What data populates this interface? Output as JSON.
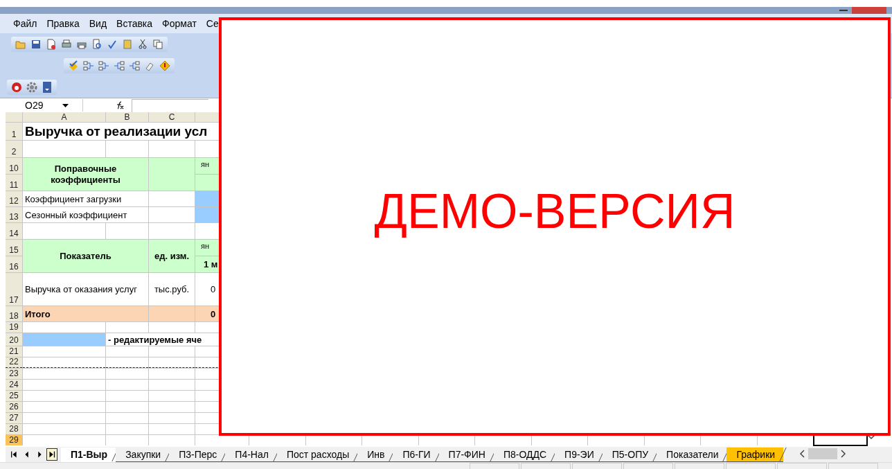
{
  "menu": [
    "Файл",
    "Правка",
    "Вид",
    "Вставка",
    "Формат",
    "Се"
  ],
  "formula_bar": {
    "name_box": "O29"
  },
  "columns": [
    "A",
    "B",
    "C"
  ],
  "rows": [
    {
      "number": "1",
      "selected": false,
      "page_break": false,
      "cells": [
        {
          "kind": "title",
          "text": "Выручка от реализации усл"
        }
      ]
    },
    {
      "number": "2",
      "selected": false,
      "page_break": false,
      "cells": []
    },
    {
      "number": "10",
      "selected": false,
      "page_break": false,
      "cells": [
        {
          "kind": "header",
          "text": "Поправочные коэффициенты"
        },
        {
          "kind": "header"
        },
        {
          "kind": "subheader",
          "text": "ян"
        }
      ]
    },
    {
      "number": "11",
      "selected": false,
      "page_break": false,
      "cells": [
        {
          "kind": "header"
        }
      ]
    },
    {
      "number": "12",
      "selected": false,
      "page_break": false,
      "cells": [
        {
          "kind": "label",
          "text": "Коэффициент загрузки"
        },
        {
          "kind": "plain"
        },
        {
          "kind": "edit"
        }
      ]
    },
    {
      "number": "13",
      "selected": false,
      "page_break": false,
      "cells": [
        {
          "kind": "label",
          "text": "Сезонный коэффициент"
        },
        {
          "kind": "plain"
        },
        {
          "kind": "edit"
        }
      ]
    },
    {
      "number": "14",
      "selected": false,
      "page_break": false,
      "cells": []
    },
    {
      "number": "15",
      "selected": false,
      "page_break": false,
      "cells": [
        {
          "kind": "header",
          "text": "Показатель"
        },
        {
          "kind": "header",
          "text": "ед. изм."
        },
        {
          "kind": "subheader",
          "text": "ян"
        }
      ]
    },
    {
      "number": "16",
      "selected": false,
      "page_break": false,
      "cells": [
        {
          "kind": "header",
          "text": "1 м"
        }
      ]
    },
    {
      "number": "17",
      "selected": false,
      "page_break": false,
      "cells": [
        {
          "kind": "label",
          "text": "Выручка от оказания услуг"
        },
        {
          "kind": "unit",
          "text": "тыс.руб."
        },
        {
          "kind": "value",
          "text": "0"
        }
      ]
    },
    {
      "number": "18",
      "selected": false,
      "page_break": false,
      "cells": [
        {
          "kind": "total",
          "text": "Итого"
        },
        {
          "kind": "total"
        },
        {
          "kind": "total_value",
          "text": "0"
        }
      ]
    },
    {
      "number": "19",
      "selected": false,
      "page_break": false,
      "cells": []
    },
    {
      "number": "20",
      "selected": false,
      "page_break": false,
      "cells": [
        {
          "kind": "edit"
        },
        {
          "kind": "note",
          "text": "- редактируемые яче"
        }
      ]
    },
    {
      "number": "21",
      "selected": false,
      "page_break": false,
      "cells": []
    },
    {
      "number": "22",
      "selected": false,
      "page_break": true,
      "cells": []
    },
    {
      "number": "23",
      "selected": false,
      "page_break": false,
      "cells": []
    },
    {
      "number": "24",
      "selected": false,
      "page_break": false,
      "cells": []
    },
    {
      "number": "25",
      "selected": false,
      "page_break": false,
      "cells": []
    },
    {
      "number": "26",
      "selected": false,
      "page_break": false,
      "cells": []
    },
    {
      "number": "27",
      "selected": false,
      "page_break": false,
      "cells": []
    },
    {
      "number": "28",
      "selected": false,
      "page_break": false,
      "cells": []
    },
    {
      "number": "29",
      "selected": true,
      "page_break": false,
      "cells": []
    }
  ],
  "sheet_tabs": [
    {
      "label": "П1-Выр",
      "selected": true
    },
    {
      "label": "Закупки",
      "selected": false
    },
    {
      "label": "П3-Перс",
      "selected": false
    },
    {
      "label": "П4-Нал",
      "selected": false
    },
    {
      "label": "Пост расходы",
      "selected": false
    },
    {
      "label": "Инв",
      "selected": false
    },
    {
      "label": "П6-ГИ",
      "selected": false
    },
    {
      "label": "П7-ФИН",
      "selected": false
    },
    {
      "label": "П8-ОДДС",
      "selected": false
    },
    {
      "label": "П9-ЭИ",
      "selected": false
    },
    {
      "label": "П5-ОПУ",
      "selected": false
    },
    {
      "label": "Показатели",
      "selected": false
    },
    {
      "label": "Графики",
      "selected": false,
      "color": "#ffc000"
    }
  ],
  "overlay": {
    "text": "ДЕМО-ВЕРСИЯ"
  }
}
